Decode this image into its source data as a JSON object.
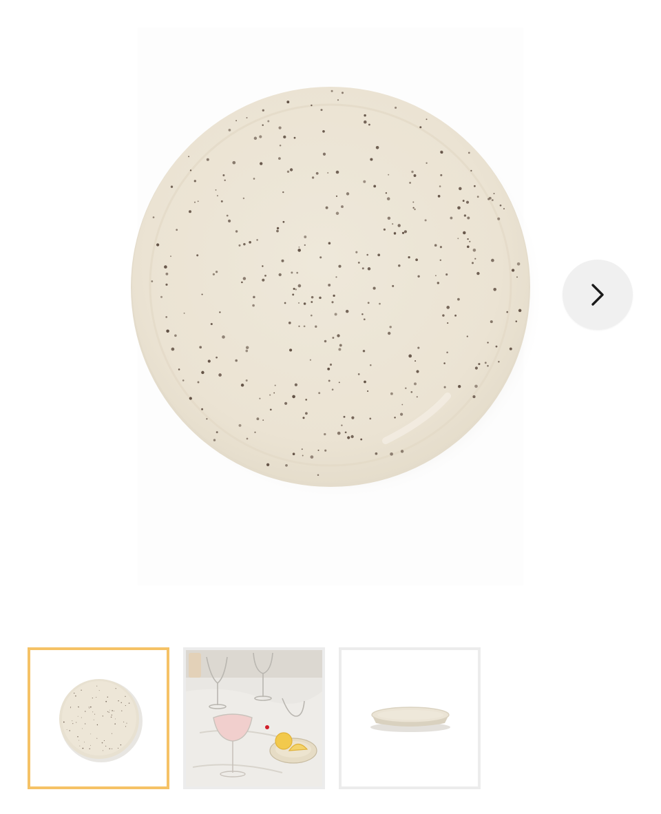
{
  "gallery": {
    "main_image_icon": "speckled-plate-top-view",
    "next_icon": "chevron-right-icon",
    "selected_index": 0,
    "selected_border_color": "#f5c266",
    "thumbnails": [
      {
        "icon": "speckled-plate-top-view",
        "selected": true
      },
      {
        "icon": "table-setting-with-glasses-and-lemon-plate",
        "selected": false
      },
      {
        "icon": "plate-side-view",
        "selected": false
      }
    ]
  },
  "colors": {
    "plate": "#ebe4d5",
    "plate_rim": "#e2dac8",
    "speckle": "#5b4a3e",
    "nav_button_bg": "#f0f0f0",
    "thumb_border": "#ececec"
  }
}
